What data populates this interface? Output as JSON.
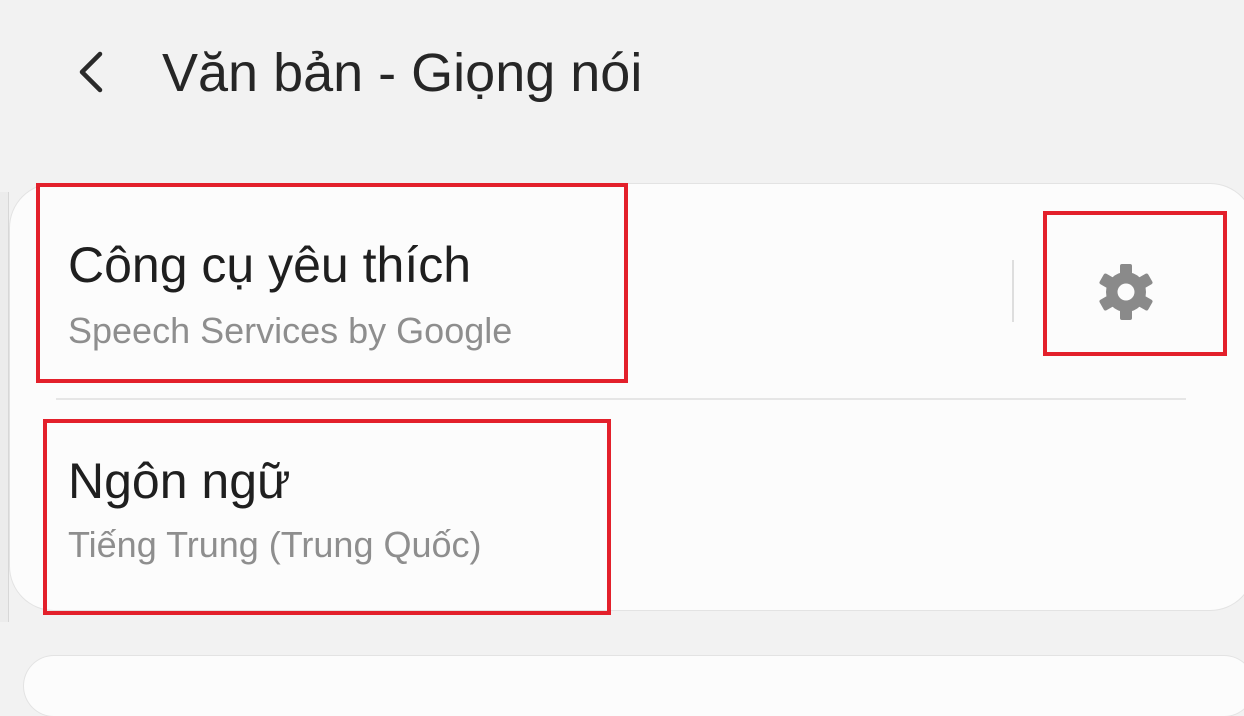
{
  "header": {
    "title": "Văn bản - Giọng nói",
    "back_icon": "chevron-left-icon"
  },
  "settings": {
    "preferred_engine": {
      "title": "Công cụ yêu thích",
      "value": "Speech Services by Google",
      "settings_icon": "gear-icon"
    },
    "language": {
      "title": "Ngôn ngữ",
      "value": "Tiếng Trung (Trung Quốc)"
    }
  },
  "colors": {
    "background": "#f2f2f2",
    "card": "#fcfcfc",
    "title_text": "#1f1f1f",
    "subtitle_text": "#8e8e8e",
    "icon": "#8a8a8a",
    "highlight": "#e3202b"
  }
}
